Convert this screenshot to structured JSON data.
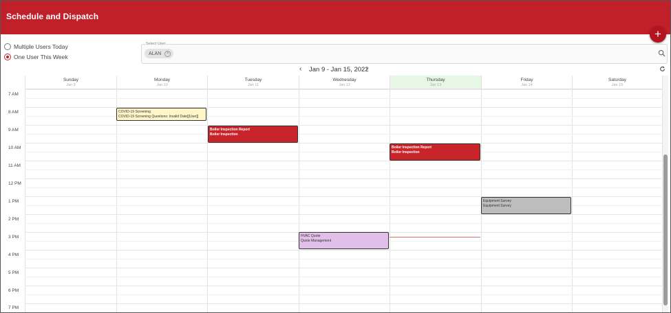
{
  "header": {
    "title": "Schedule and Dispatch",
    "add_icon": "plus-icon"
  },
  "view_options": [
    {
      "label": "Multiple Users Today",
      "checked": false
    },
    {
      "label": "One User This Week",
      "checked": true
    }
  ],
  "user_select": {
    "label": "Select User",
    "chip": "ALAN",
    "search_icon": "search-icon"
  },
  "week_nav": {
    "range": "Jan 9 - Jan 15, 2022",
    "prev": "‹",
    "next": "›"
  },
  "days": [
    {
      "name": "Sunday",
      "date": "Jan 9"
    },
    {
      "name": "Monday",
      "date": "Jan 10"
    },
    {
      "name": "Tuesday",
      "date": "Jan 11"
    },
    {
      "name": "Wednesday",
      "date": "Jan 12"
    },
    {
      "name": "Thursday",
      "date": "Jan 13"
    },
    {
      "name": "Friday",
      "date": "Jan 14"
    },
    {
      "name": "Saturday",
      "date": "Jan 15"
    }
  ],
  "times": [
    "7 AM",
    "8 AM",
    "9 AM",
    "10 AM",
    "11 AM",
    "12 PM",
    "1 PM",
    "2 PM",
    "3 PM",
    "4 PM",
    "5 PM",
    "6 PM",
    "7 PM"
  ],
  "events": [
    {
      "line1": "COVID-19 Screening",
      "line2": "COVID-19 Screening Questions: Invalid Date[[User]]"
    },
    {
      "line1": "Boiler Inspection Report",
      "line2": "Boiler Inspection"
    },
    {
      "line1": "Boiler Inspection Report",
      "line2": "Boiler Inspection"
    },
    {
      "line1": "Equipment Survey",
      "line2": "Equipment Survey"
    },
    {
      "line1": "HVAC Quote",
      "line2": "Quote Management"
    }
  ],
  "colors": {
    "brand": "#c0202a",
    "today": "#e6f7e6",
    "event_red": "#c8242a",
    "event_yellow": "#fff6c8",
    "event_gray": "#bdbdbd",
    "event_purple": "#e2bfe8"
  }
}
